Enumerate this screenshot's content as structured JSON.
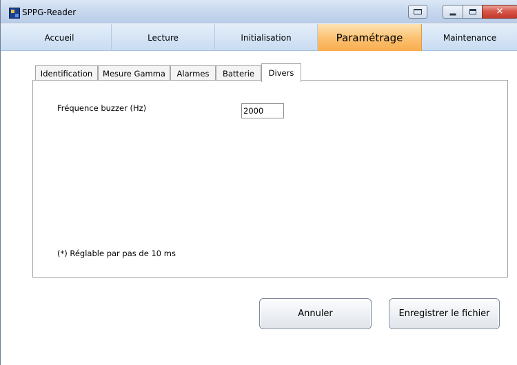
{
  "window": {
    "title": "SPPG-Reader"
  },
  "nav": {
    "tabs": [
      {
        "label": "Accueil"
      },
      {
        "label": "Lecture"
      },
      {
        "label": "Initialisation"
      },
      {
        "label": "Paramétrage"
      },
      {
        "label": "Maintenance"
      }
    ],
    "active": "Paramétrage"
  },
  "subtabs": {
    "items": [
      {
        "label": "Identification"
      },
      {
        "label": "Mesure Gamma"
      },
      {
        "label": "Alarmes"
      },
      {
        "label": "Batterie"
      },
      {
        "label": "Divers"
      }
    ],
    "active": "Divers"
  },
  "form": {
    "buzzer_label": "Fréquence buzzer (Hz)",
    "buzzer_value": "2000",
    "note": "(*)  Réglable par pas de 10 ms"
  },
  "actions": {
    "cancel_label": "Annuler",
    "save_label": "Enregistrer le fichier"
  },
  "colors": {
    "active_tab": "#fbc06f",
    "titlebar": "#c9d9ee",
    "close_button": "#d9574a"
  }
}
